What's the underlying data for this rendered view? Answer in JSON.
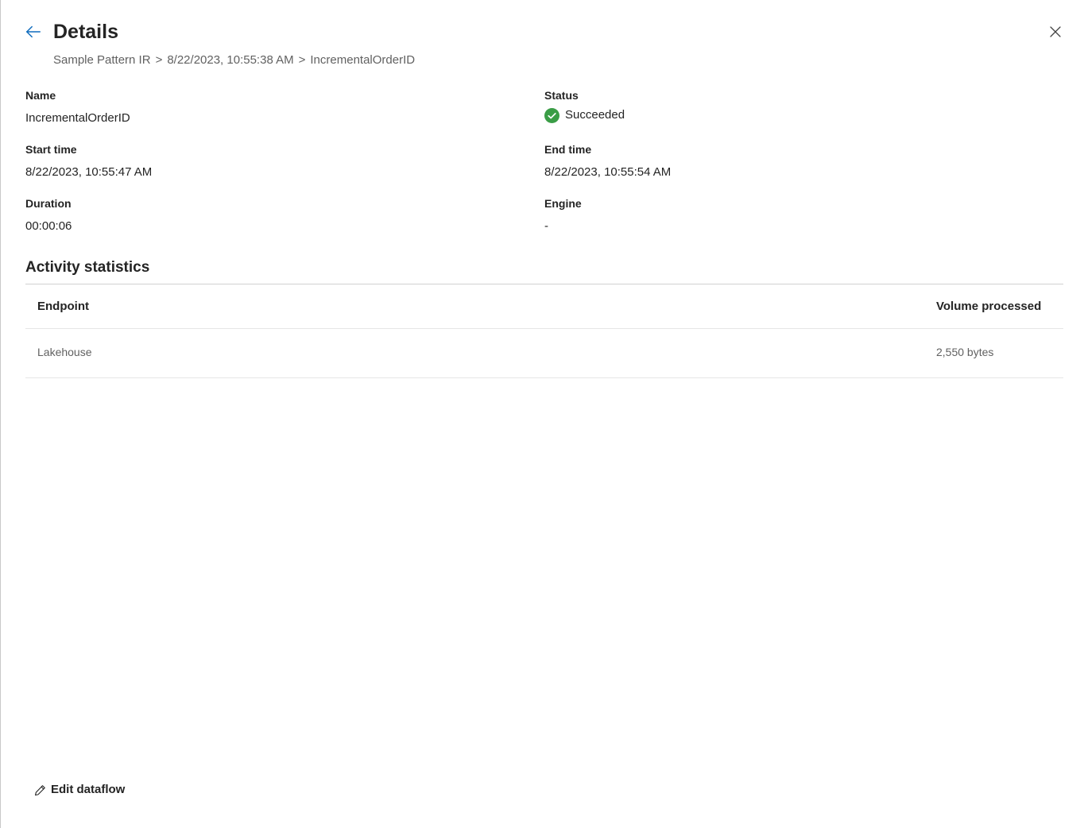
{
  "header": {
    "title": "Details",
    "back_icon": "arrow-left-icon",
    "close_icon": "close-icon"
  },
  "breadcrumb": {
    "items": [
      "Sample Pattern IR",
      "8/22/2023, 10:55:38 AM",
      "IncrementalOrderID"
    ],
    "separator": ">"
  },
  "fields": {
    "name": {
      "label": "Name",
      "value": "IncrementalOrderID"
    },
    "status": {
      "label": "Status",
      "value": "Succeeded",
      "icon": "check-circle-icon",
      "color": "#3a9d46"
    },
    "start_time": {
      "label": "Start time",
      "value": "8/22/2023, 10:55:47 AM"
    },
    "end_time": {
      "label": "End time",
      "value": "8/22/2023, 10:55:54 AM"
    },
    "duration": {
      "label": "Duration",
      "value": "00:00:06"
    },
    "engine": {
      "label": "Engine",
      "value": "-"
    }
  },
  "activity_statistics": {
    "title": "Activity statistics",
    "columns": [
      "Endpoint",
      "Volume processed"
    ],
    "rows": [
      {
        "endpoint": "Lakehouse",
        "volume": "2,550 bytes"
      }
    ]
  },
  "footer": {
    "edit_label": "Edit dataflow",
    "edit_icon": "pencil-icon"
  },
  "colors": {
    "accent": "#0f6cbd",
    "success": "#3a9d46"
  }
}
